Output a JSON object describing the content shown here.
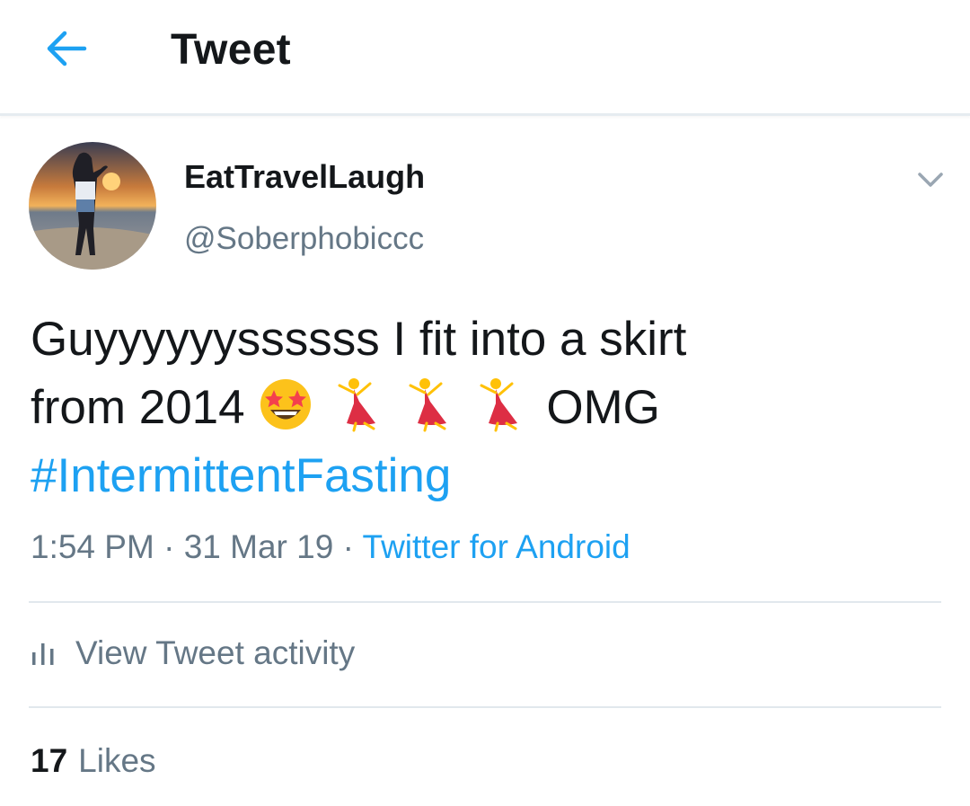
{
  "header": {
    "title": "Tweet",
    "back_icon": "arrow-left-icon"
  },
  "author": {
    "display_name": "EatTravelLaugh",
    "handle": "@Soberphobiccc"
  },
  "tweet": {
    "line1": "Guyyyyyyssssss I fit into a skirt",
    "line2_prefix": "from 2014",
    "emoji": [
      "star-struck-emoji",
      "woman-dancing-emoji",
      "woman-dancing-emoji",
      "woman-dancing-emoji"
    ],
    "line2_suffix": "OMG",
    "hashtag": "#IntermittentFasting"
  },
  "meta": {
    "time": "1:54 PM",
    "separator": "·",
    "date": "31 Mar 19",
    "source": "Twitter for Android"
  },
  "activity": {
    "label": "View Tweet activity",
    "icon": "analytics-bars-icon"
  },
  "likes": {
    "count": "17",
    "label": "Likes"
  },
  "colors": {
    "accent": "#1da1f2",
    "secondary_text": "#657786",
    "divider": "#e1e8ed"
  }
}
